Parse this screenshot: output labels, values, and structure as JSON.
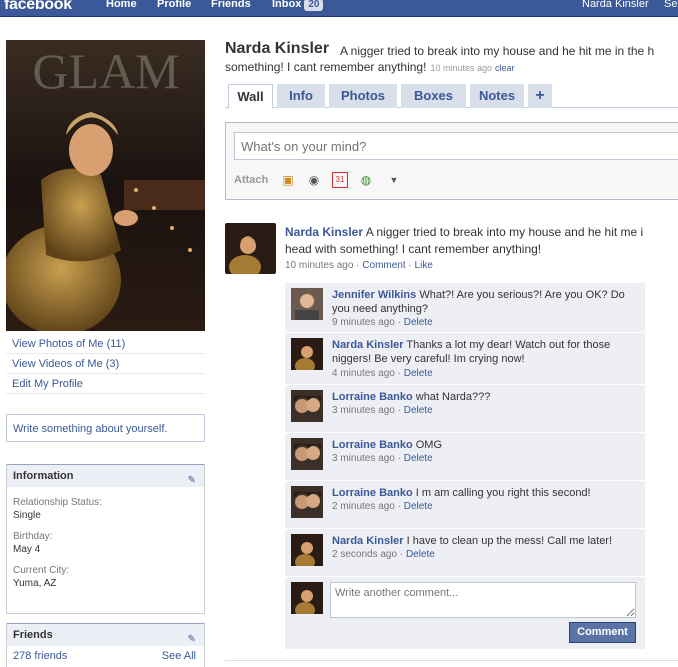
{
  "topbar": {
    "logo": "facebook",
    "home": "Home",
    "profile": "Profile",
    "friends": "Friends",
    "inbox": "Inbox",
    "inbox_count": "20",
    "user": "Narda Kinsler",
    "settings": "Se"
  },
  "left": {
    "photo_text": "GLAM",
    "links": [
      "View Photos of Me (11)",
      "View Videos of Me (3)",
      "Edit My Profile"
    ],
    "write_about": "Write something about yourself.",
    "information": {
      "title": "Information",
      "fields": [
        {
          "label": "Relationship Status:",
          "value": "Single"
        },
        {
          "label": "Birthday:",
          "value": "May 4"
        },
        {
          "label": "Current City:",
          "value": "Yuma, AZ"
        }
      ]
    },
    "friends": {
      "title": "Friends",
      "count": "278 friends",
      "see_all": "See All"
    }
  },
  "header": {
    "name": "Narda Kinsler",
    "status_line1": "A nigger tried to break into my house and he hit me in the h",
    "status_line2": "something! I cant remember anything!",
    "status_time": "10 minutes ago",
    "status_clear": "clear"
  },
  "tabs": [
    "Wall",
    "Info",
    "Photos",
    "Boxes",
    "Notes",
    "+"
  ],
  "publisher": {
    "placeholder": "What's on your mind?",
    "attach": "Attach"
  },
  "story": {
    "name": "Narda Kinsler",
    "line1": "A nigger tried to break into my house and he hit me i",
    "line2": "head with something! I cant remember anything!",
    "time": "10 minutes ago",
    "comment": "Comment",
    "like": "Like"
  },
  "comments": [
    {
      "name": "Jennifer Wilkins",
      "text": "What?! Are you serious?! Are you OK? Do you need anything?",
      "time": "9 minutes ago",
      "action": "Delete"
    },
    {
      "name": "Narda Kinsler",
      "text": "Thanks a lot my dear! Watch out for those niggers! Be very careful! Im crying now!",
      "time": "4 minutes ago",
      "action": "Delete"
    },
    {
      "name": "Lorraine Banko",
      "text": "what Narda???",
      "time": "3 minutes ago",
      "action": "Delete"
    },
    {
      "name": "Lorraine Banko",
      "text": "OMG",
      "time": "3 minutes ago",
      "action": "Delete"
    },
    {
      "name": "Lorraine Banko",
      "text": "I m am calling you right this second!",
      "time": "2 minutes ago",
      "action": "Delete"
    },
    {
      "name": "Narda Kinsler",
      "text": "I have to clean up the mess! Call me later!",
      "time": "2 seconds ago",
      "action": "Delete"
    }
  ],
  "write_comment": {
    "placeholder": "Write another comment...",
    "button": "Comment"
  },
  "colors": {
    "brand": "#3b5998",
    "tab_bg": "#d8dfea",
    "comment_bg": "#edeff4"
  }
}
